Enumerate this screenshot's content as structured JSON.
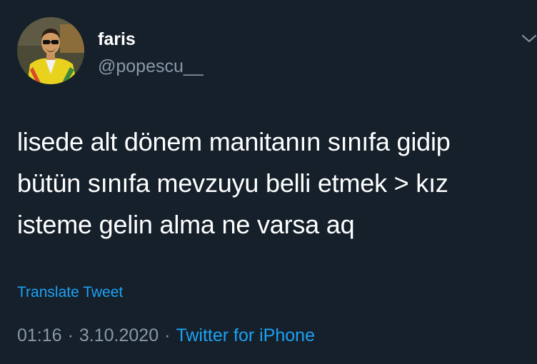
{
  "tweet": {
    "display_name": "faris",
    "handle": "@popescu__",
    "text": "lisede alt dönem manitanın sınıfa gidip\nbütün sınıfa mevzuyu belli etmek > kız\nisteme gelin alma ne varsa aq",
    "translate_label": "Translate Tweet",
    "time": "01:16",
    "date": "3.10.2020",
    "separator": "·",
    "source": "Twitter for iPhone"
  },
  "icons": {
    "avatar": "user-photo",
    "menu": "chevron-down-icon"
  },
  "colors": {
    "background": "#15202b",
    "primary_text": "#ffffff",
    "secondary_text": "#8899a6",
    "link": "#1da1f2"
  }
}
